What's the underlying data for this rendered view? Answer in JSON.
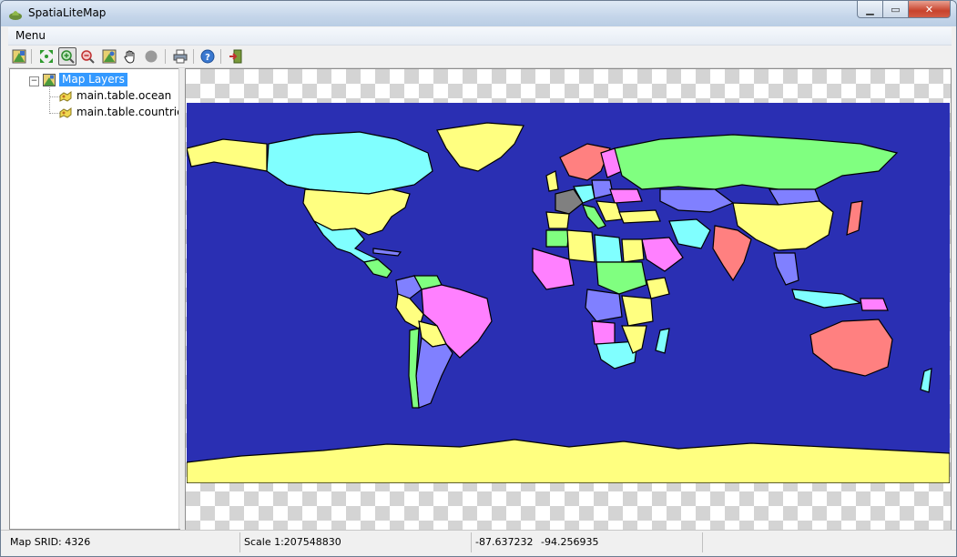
{
  "window": {
    "title": "SpatiaLiteMap"
  },
  "menubar": {
    "items": [
      "Menu"
    ]
  },
  "toolbar": {
    "buttons": [
      {
        "icon": "layer-config-icon"
      },
      {
        "icon": "zoom-full-extent-icon"
      },
      {
        "icon": "zoom-in-icon",
        "active": true
      },
      {
        "icon": "zoom-out-icon"
      },
      {
        "icon": "identify-icon"
      },
      {
        "icon": "pan-hand-icon"
      },
      {
        "icon": "stop-icon"
      },
      {
        "icon": "print-icon"
      },
      {
        "icon": "help-icon"
      },
      {
        "icon": "exit-icon"
      }
    ]
  },
  "tree": {
    "root": {
      "label": "Map Layers",
      "expander": "−"
    },
    "layers": [
      {
        "label": "main.table.ocean"
      },
      {
        "label": "main.table.countries"
      }
    ]
  },
  "statusbar": {
    "srid": "Map SRID: 4326",
    "scale": "Scale 1:207548830",
    "lon": "-87.637232",
    "lat": "-94.256935"
  },
  "colors": {
    "ocean": "#2a2fb3",
    "selection": "#3399ff",
    "country_fills": [
      "#ffff80",
      "#80ffff",
      "#ff80ff",
      "#80ff80",
      "#8080ff",
      "#ff8080",
      "#808080"
    ]
  }
}
